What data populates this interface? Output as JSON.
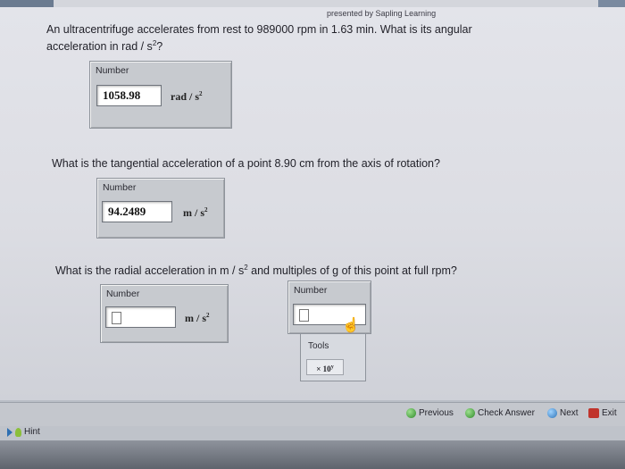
{
  "header": {
    "credit": "presented by Sapling Learning"
  },
  "q1": {
    "text_line1": "An ultracentrifuge accelerates from rest to 989000 rpm in 1.63 min. What is its angular",
    "text_line2_a": "acceleration in rad / s",
    "text_line2_sup": "2",
    "text_line2_b": "?",
    "number_label": "Number",
    "value": "1058.98",
    "unit_main": "rad / s",
    "unit_sup": "2"
  },
  "q2": {
    "text": "What is the tangential acceleration of a point 8.90 cm from the axis of rotation?",
    "number_label": "Number",
    "value": "94.2489",
    "unit_main": "m / s",
    "unit_sup": "2"
  },
  "q3": {
    "text_a": "What is the radial acceleration in m / s",
    "text_sup": "2",
    "text_b": " and multiples of g of this point at full rpm?",
    "box1": {
      "number_label": "Number",
      "value": "",
      "unit_main": "m / s",
      "unit_sup": "2"
    },
    "box2": {
      "number_label": "Number",
      "value": ""
    }
  },
  "tools": {
    "label": "Tools",
    "button_main": "× 10",
    "button_sup": "y"
  },
  "nav": {
    "previous": "Previous",
    "check_answer": "Check Answer",
    "next": "Next",
    "exit": "Exit"
  },
  "hint": {
    "label": "Hint"
  }
}
